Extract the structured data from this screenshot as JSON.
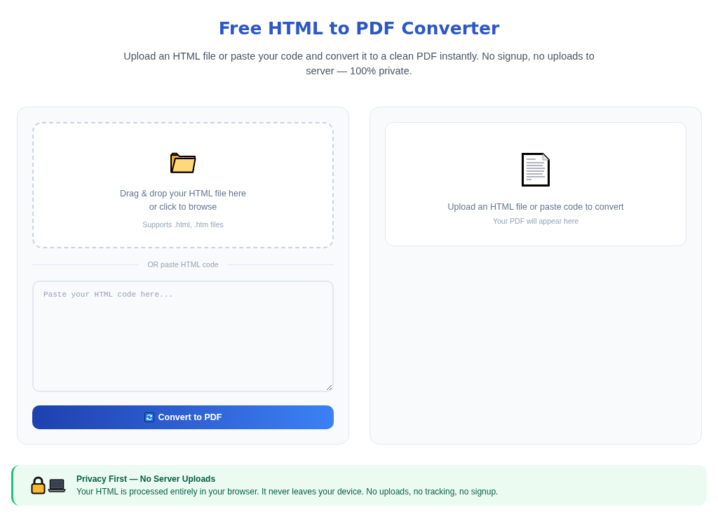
{
  "header": {
    "title": "Free HTML to PDF Converter",
    "subtitle": "Upload an HTML file or paste your code and convert it to a clean PDF instantly. No signup, no uploads to server — 100% private."
  },
  "upload_panel": {
    "dropzone": {
      "line_1": "Drag & drop your HTML file here",
      "line_2": "or click to browse",
      "hint": "Supports .html, .htm files"
    },
    "divider_label": "OR paste HTML code",
    "code_input": {
      "placeholder": "Paste your HTML code here..."
    },
    "convert_button": {
      "label": "Convert to PDF"
    }
  },
  "preview_panel": {
    "message": "Upload an HTML file or paste code to convert",
    "hint": "Your PDF will appear here"
  },
  "privacy_notice": {
    "title": "Privacy First — No Server Uploads",
    "text": "Your HTML is processed entirely in your browser. It never leaves your device. No uploads, no tracking, no signup."
  }
}
